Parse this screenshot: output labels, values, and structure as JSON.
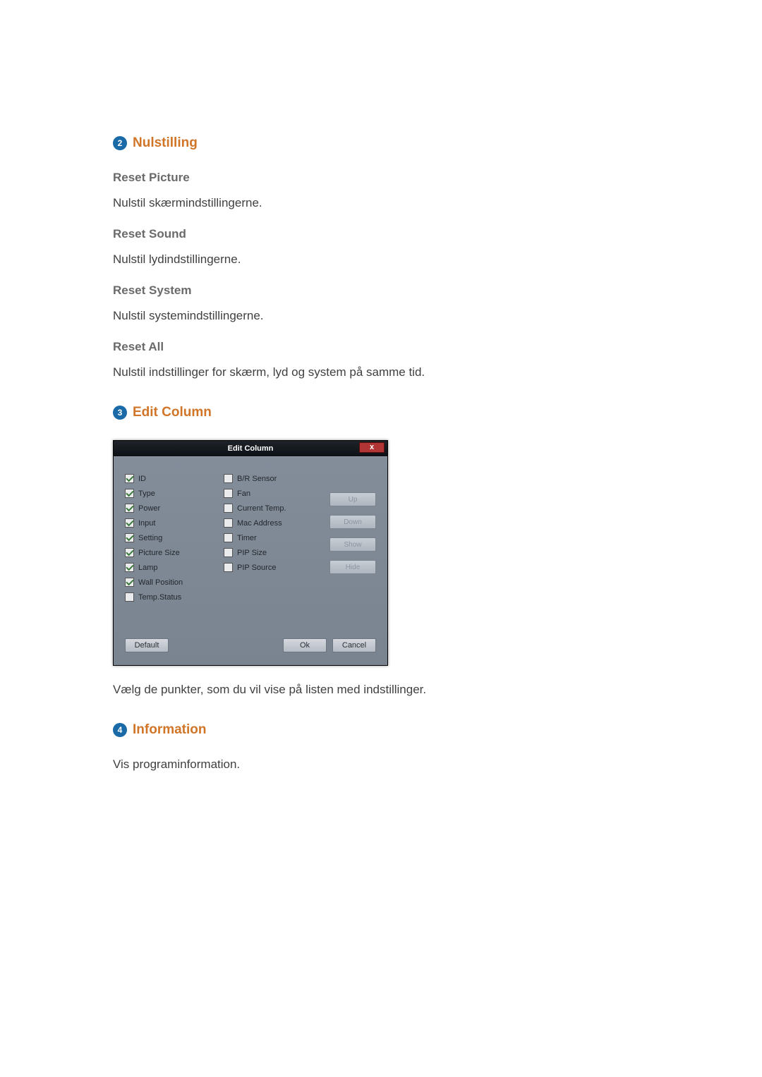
{
  "sections": {
    "s2": {
      "num": "2",
      "title": "Nulstilling"
    },
    "s3": {
      "num": "3",
      "title": "Edit Column"
    },
    "s4": {
      "num": "4",
      "title": "Information"
    }
  },
  "reset": {
    "picture": {
      "heading": "Reset Picture",
      "body": "Nulstil skærmindstillingerne."
    },
    "sound": {
      "heading": "Reset Sound",
      "body": "Nulstil lydindstillingerne."
    },
    "system": {
      "heading": "Reset System",
      "body": "Nulstil systemindstillingerne."
    },
    "all": {
      "heading": "Reset All",
      "body": "Nulstil indstillinger for skærm, lyd og system på samme tid."
    }
  },
  "dialog": {
    "title": "Edit Column",
    "close": "x",
    "col1": [
      {
        "label": "ID",
        "checked": true
      },
      {
        "label": "Type",
        "checked": true
      },
      {
        "label": "Power",
        "checked": true
      },
      {
        "label": "Input",
        "checked": true
      },
      {
        "label": "Setting",
        "checked": true
      },
      {
        "label": "Picture Size",
        "checked": true
      },
      {
        "label": "Lamp",
        "checked": true
      },
      {
        "label": "Wall Position",
        "checked": true
      },
      {
        "label": "Temp.Status",
        "checked": false
      }
    ],
    "col2": [
      {
        "label": "B/R Sensor",
        "checked": false
      },
      {
        "label": "Fan",
        "checked": false
      },
      {
        "label": "Current Temp.",
        "checked": false
      },
      {
        "label": "Mac Address",
        "checked": false
      },
      {
        "label": "Timer",
        "checked": false
      },
      {
        "label": "PIP Size",
        "checked": false
      },
      {
        "label": "PIP Source",
        "checked": false
      }
    ],
    "side": {
      "up": "Up",
      "down": "Down",
      "show": "Show",
      "hide": "Hide"
    },
    "footer": {
      "default": "Default",
      "ok": "Ok",
      "cancel": "Cancel"
    }
  },
  "editColumnCaption": "Vælg de punkter, som du vil vise på listen med indstillinger.",
  "informationBody": "Vis programinformation."
}
